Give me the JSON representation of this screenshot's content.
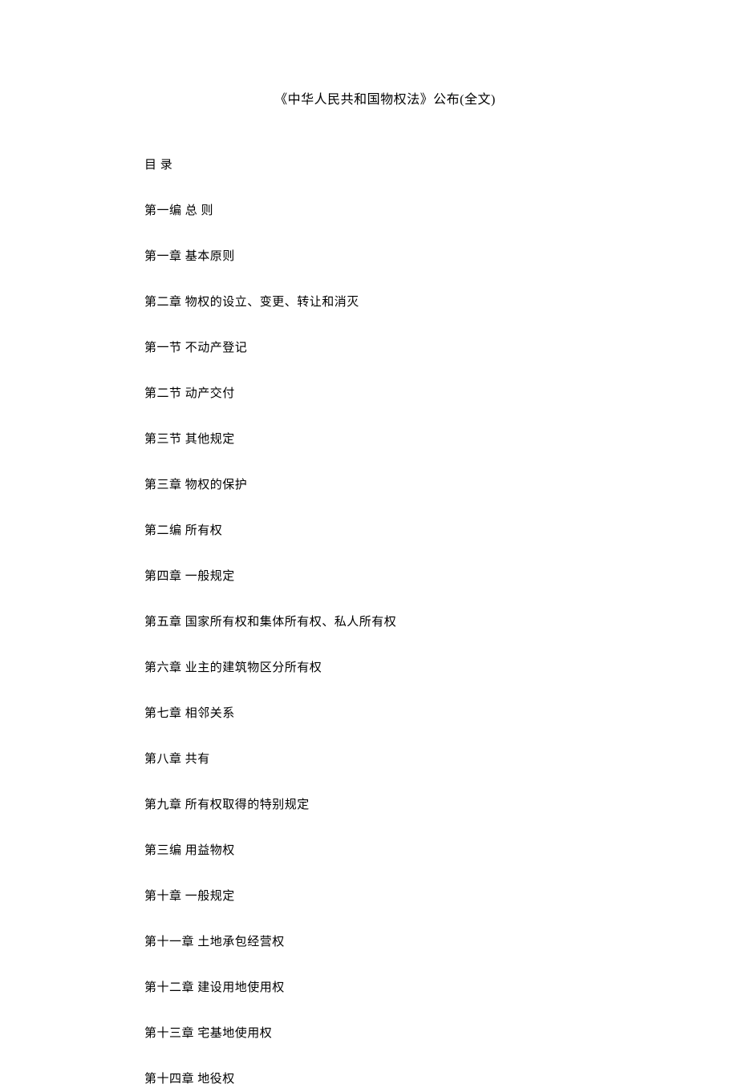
{
  "title": "《中华人民共和国物权法》公布(全文)",
  "toc": [
    "目 录",
    "第一编 总 则",
    "第一章 基本原则",
    "第二章 物权的设立、变更、转让和消灭",
    "第一节 不动产登记",
    "第二节 动产交付",
    "第三节 其他规定",
    "第三章 物权的保护",
    "第二编 所有权",
    "第四章 一般规定",
    "第五章 国家所有权和集体所有权、私人所有权",
    "第六章 业主的建筑物区分所有权",
    "第七章 相邻关系",
    "第八章 共有",
    "第九章 所有权取得的特别规定",
    "第三编 用益物权",
    "第十章 一般规定",
    "第十一章 土地承包经营权",
    "第十二章 建设用地使用权",
    "第十三章 宅基地使用权",
    "第十四章 地役权"
  ]
}
